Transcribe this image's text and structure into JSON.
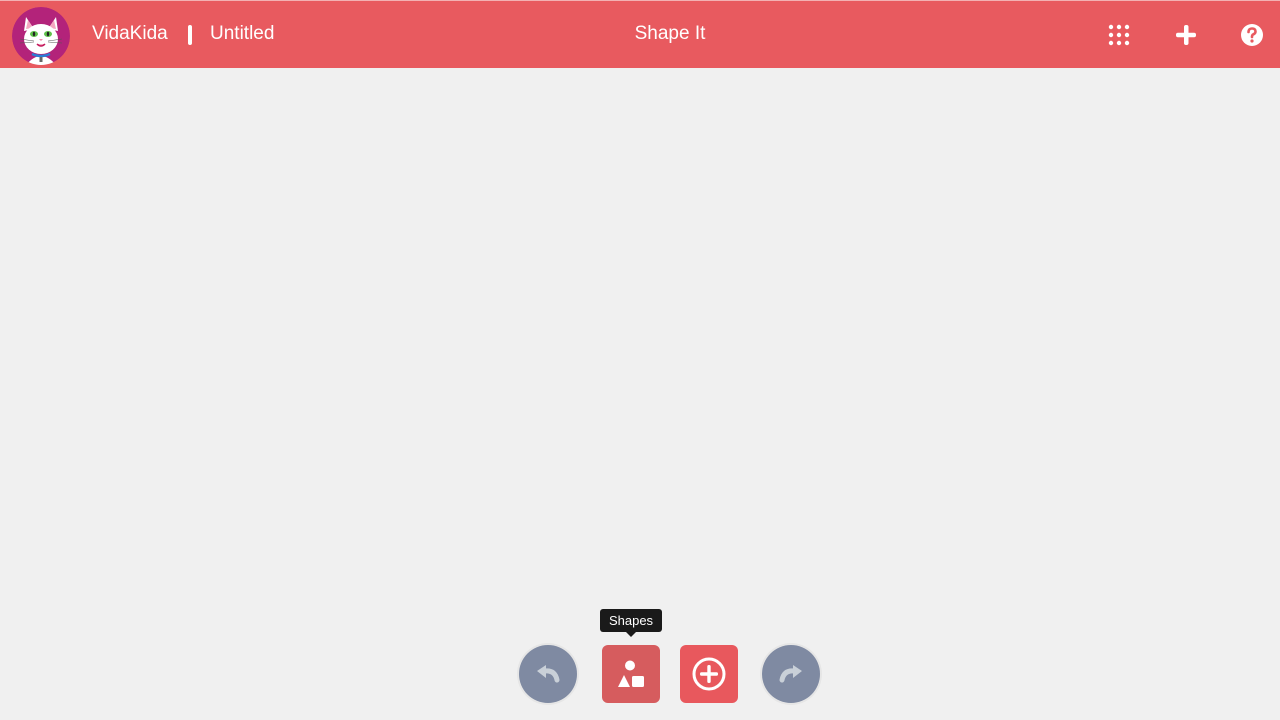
{
  "header": {
    "brand": "VidaKida",
    "document_title": "Untitled",
    "app_title": "Shape It",
    "icons": [
      "apps-grid-icon",
      "plus-icon",
      "help-icon"
    ]
  },
  "toolbar": {
    "buttons": [
      {
        "name": "undo",
        "icon": "undo-icon"
      },
      {
        "name": "shapes",
        "icon": "shapes-icon",
        "tooltip": "Shapes"
      },
      {
        "name": "add",
        "icon": "add-circle-icon"
      },
      {
        "name": "redo",
        "icon": "redo-icon"
      }
    ],
    "tooltip_text": "Shapes"
  },
  "colors": {
    "header": "#e85a5f",
    "background": "#f0f0f0",
    "shapes_button": "#d65c5e",
    "add_button": "#e8585d",
    "history_buttons": "#7f8aa2"
  }
}
